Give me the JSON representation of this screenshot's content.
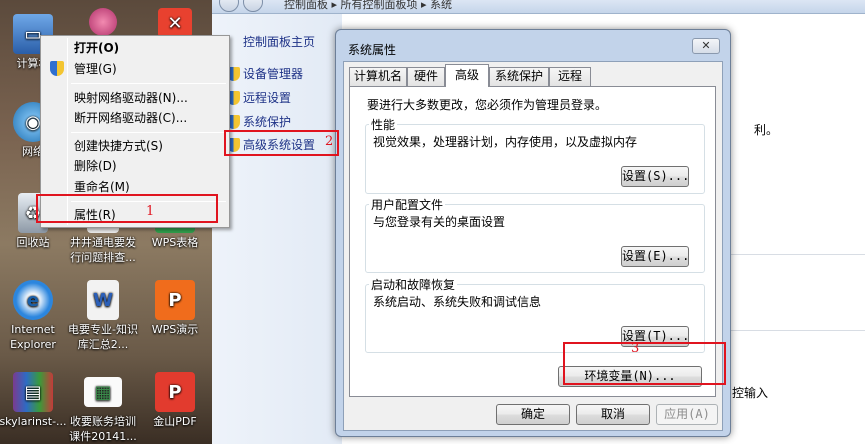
{
  "desktop": {
    "icons": [
      {
        "label": "计算机",
        "color": "#3a7bd5"
      },
      {
        "label": "网络",
        "color": "#2e8bc9"
      },
      {
        "label": "回收站",
        "color": "#9aa6b2"
      },
      {
        "label": "Internet Explorer",
        "color": "#1f74c9"
      },
      {
        "label": "skylarinst-...",
        "color": "#7a3b8f"
      },
      {
        "label": "井井通电要发行问题排查...",
        "color": "#d0d0d0"
      },
      {
        "label": "电要专业-知识库汇总2...",
        "color": "#2b5fb8"
      },
      {
        "label": "收要账务培训课件20141...",
        "color": "#e8e8e8"
      },
      {
        "label": "WPS表格",
        "color": "#e8412f"
      },
      {
        "label": "WPS演示",
        "color": "#f06c1c"
      },
      {
        "label": "金山PDF",
        "color": "#e23b2e"
      }
    ]
  },
  "context_menu": {
    "items": [
      {
        "label": "打开(O)",
        "bold": true
      },
      {
        "label": "管理(G)",
        "bold": false
      },
      {
        "label": "映射网络驱动器(N)...",
        "bold": false
      },
      {
        "label": "断开网络驱动器(C)...",
        "bold": false
      },
      {
        "label": "创建快捷方式(S)",
        "bold": false
      },
      {
        "label": "删除(D)",
        "bold": false
      },
      {
        "label": "重命名(M)",
        "bold": false
      },
      {
        "label": "属性(R)",
        "bold": false
      }
    ]
  },
  "control_panel": {
    "breadcrumb": [
      "控制面板",
      "所有控制面板项",
      "系统"
    ],
    "home_link": "控制面板主页",
    "links": [
      "设备管理器",
      "远程设置",
      "系统保护",
      "高级系统设置"
    ],
    "right_fragments": [
      "利。",
      "控输入"
    ]
  },
  "dialog": {
    "title": "系统属性",
    "close_label": "✕",
    "tabs": [
      "计算机名",
      "硬件",
      "高级",
      "系统保护",
      "远程"
    ],
    "active_tab": "高级",
    "admin_note": "要进行大多数更改，您必须作为管理员登录。",
    "groups": [
      {
        "title": "性能",
        "description": "视觉效果，处理器计划，内存使用，以及虚拟内存",
        "button": "设置(S)..."
      },
      {
        "title": "用户配置文件",
        "description": "与您登录有关的桌面设置",
        "button": "设置(E)..."
      },
      {
        "title": "启动和故障恢复",
        "description": "系统启动、系统失败和调试信息",
        "button": "设置(T)..."
      }
    ],
    "env_button": "环境变量(N)...",
    "ok": "确定",
    "cancel": "取消",
    "apply": "应用(A)"
  },
  "annotations": {
    "step1": "1",
    "step2": "2",
    "step3": "3",
    "highlight_color": "#e0141f"
  }
}
